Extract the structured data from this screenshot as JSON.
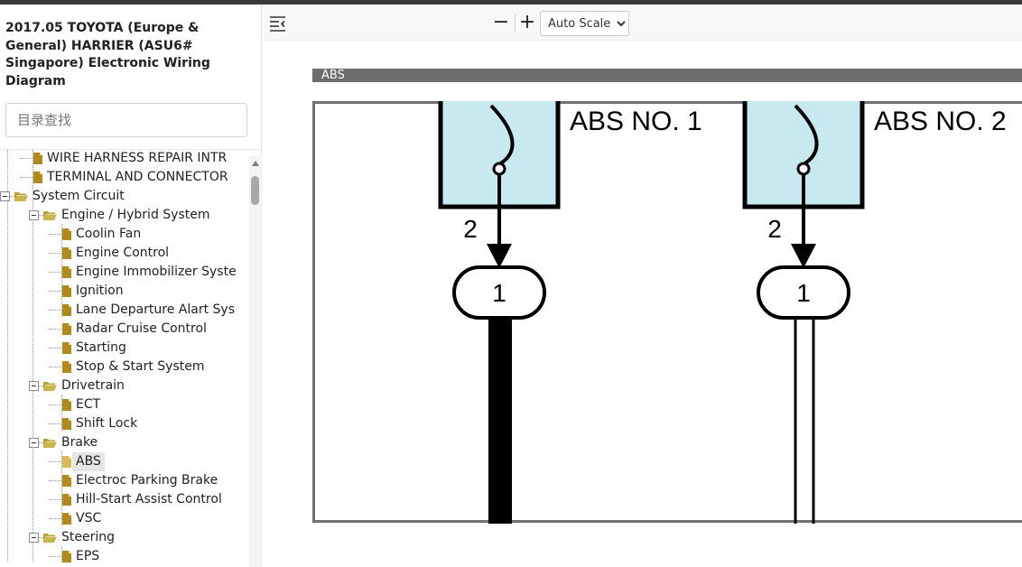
{
  "app": {
    "document_title": "2017.05 TOYOTA (Europe & General) HARRIER (ASU6# Singapore) Electronic Wiring Diagram",
    "search_placeholder": "目录查找"
  },
  "tree": [
    {
      "label": "WIRE HARNESS REPAIR INTR",
      "level": 1,
      "type": "doc"
    },
    {
      "label": "TERMINAL AND CONNECTOR",
      "level": 1,
      "type": "doc"
    },
    {
      "label": "System Circuit",
      "level": 0,
      "type": "folder"
    },
    {
      "label": "Engine / Hybrid System",
      "level": 1,
      "type": "folder"
    },
    {
      "label": "Coolin Fan",
      "level": 2,
      "type": "doc"
    },
    {
      "label": "Engine Control",
      "level": 2,
      "type": "doc"
    },
    {
      "label": "Engine Immobilizer Syste",
      "level": 2,
      "type": "doc"
    },
    {
      "label": "Ignition",
      "level": 2,
      "type": "doc"
    },
    {
      "label": "Lane Departure Alart Sys",
      "level": 2,
      "type": "doc"
    },
    {
      "label": "Radar Cruise Control",
      "level": 2,
      "type": "doc"
    },
    {
      "label": "Starting",
      "level": 2,
      "type": "doc"
    },
    {
      "label": "Stop & Start System",
      "level": 2,
      "type": "doc"
    },
    {
      "label": "Drivetrain",
      "level": 1,
      "type": "folder"
    },
    {
      "label": "ECT",
      "level": 2,
      "type": "doc"
    },
    {
      "label": "Shift Lock",
      "level": 2,
      "type": "doc"
    },
    {
      "label": "Brake",
      "level": 1,
      "type": "folder"
    },
    {
      "label": "ABS",
      "level": 2,
      "type": "doc",
      "selected": true
    },
    {
      "label": "Electroc Parking Brake",
      "level": 2,
      "type": "doc"
    },
    {
      "label": "Hill-Start Assist Control",
      "level": 2,
      "type": "doc"
    },
    {
      "label": "VSC",
      "level": 2,
      "type": "doc"
    },
    {
      "label": "Steering",
      "level": 1,
      "type": "folder"
    },
    {
      "label": "EPS",
      "level": 2,
      "type": "doc"
    }
  ],
  "toolbar": {
    "zoom_out_label": "−",
    "zoom_in_label": "+",
    "scale_selected": "Auto Scale"
  },
  "viewer": {
    "section_title": "ABS",
    "fuses": [
      {
        "name": "ABS NO. 1",
        "pin": "2",
        "connector": "1",
        "wire": "solid"
      },
      {
        "name": "ABS NO. 2",
        "pin": "2",
        "connector": "1",
        "wire": "hollow"
      }
    ]
  },
  "colors": {
    "folder": "#b8a33a",
    "doc_icon": "#b08b1c",
    "fuse_fill": "#c9e9f1",
    "section_bar": "#6d6d6d"
  }
}
